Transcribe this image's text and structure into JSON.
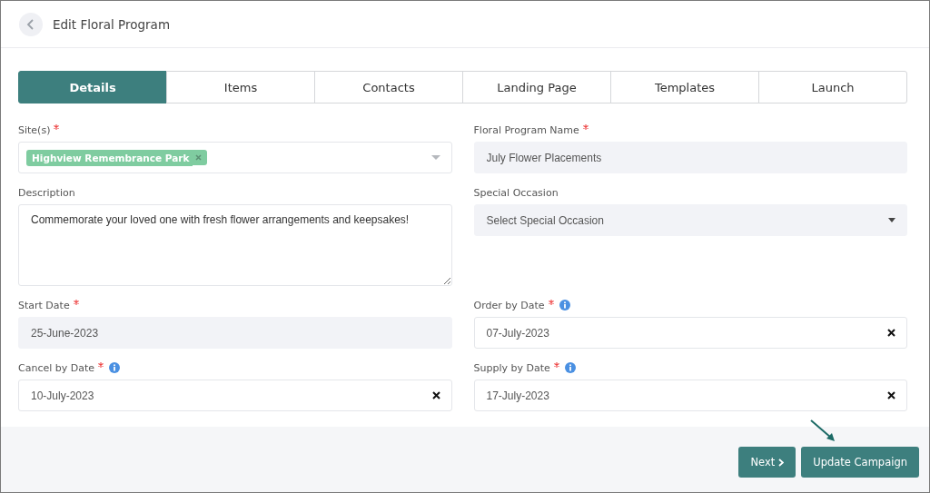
{
  "header": {
    "title": "Edit Floral Program"
  },
  "tabs": [
    {
      "label": "Details",
      "selected": true
    },
    {
      "label": "Items",
      "selected": false
    },
    {
      "label": "Contacts",
      "selected": false
    },
    {
      "label": "Landing Page",
      "selected": false
    },
    {
      "label": "Templates",
      "selected": false
    },
    {
      "label": "Launch",
      "selected": false
    }
  ],
  "fields": [
    {
      "kind": "tags",
      "label": "Site(s)",
      "required": true,
      "info": false,
      "disabled": false,
      "tags": [
        "Highview Remembrance Park"
      ]
    },
    {
      "kind": "text",
      "label": "Floral Program Name",
      "required": true,
      "info": false,
      "disabled": true,
      "value": "July Flower Placements"
    },
    {
      "kind": "textarea",
      "label": "Description",
      "required": false,
      "info": false,
      "disabled": false,
      "value": "Commemorate your loved one with fresh flower arrangements and keepsakes!"
    },
    {
      "kind": "select",
      "label": "Special Occasion",
      "required": false,
      "info": false,
      "disabled": true,
      "placeholder": "Select Special Occasion"
    },
    {
      "kind": "date",
      "label": "Start Date",
      "required": true,
      "info": false,
      "disabled": true,
      "clearable": false,
      "value": "25-June-2023"
    },
    {
      "kind": "date",
      "label": "Order by Date",
      "required": true,
      "info": true,
      "disabled": false,
      "clearable": true,
      "value": "07-July-2023"
    },
    {
      "kind": "date",
      "label": "Cancel by Date",
      "required": true,
      "info": true,
      "disabled": false,
      "clearable": true,
      "value": "10-July-2023"
    },
    {
      "kind": "date",
      "label": "Supply by Date",
      "required": true,
      "info": true,
      "disabled": false,
      "clearable": true,
      "value": "17-July-2023"
    }
  ],
  "footer": {
    "buttons": [
      {
        "label": "Next",
        "kind": "next"
      },
      {
        "label": "Update Campaign",
        "kind": "plain"
      }
    ]
  }
}
